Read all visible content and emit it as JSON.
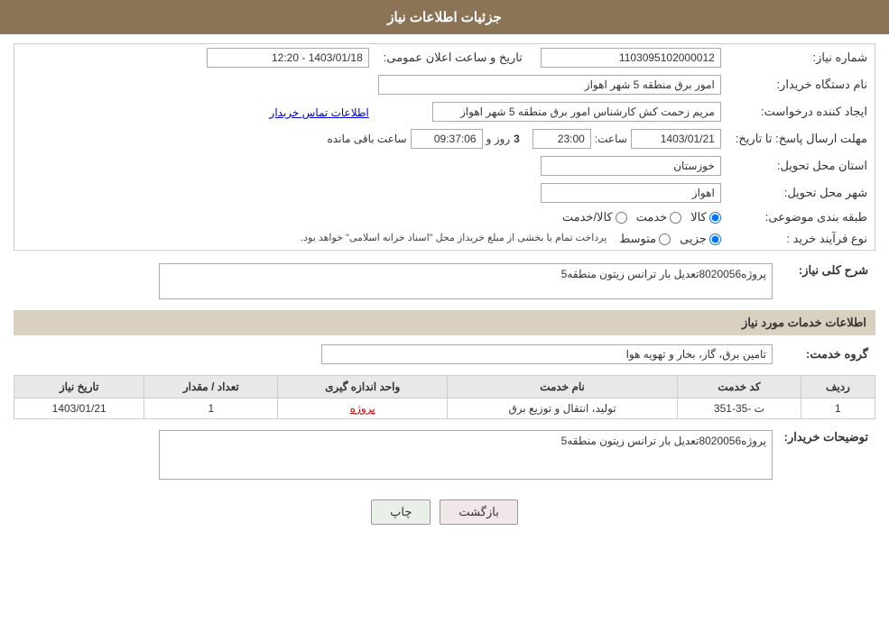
{
  "header": {
    "title": "جزئیات اطلاعات نیاز"
  },
  "form": {
    "shomara_niaz_label": "شماره نیاز:",
    "shomara_niaz_value": "1103095102000012",
    "name_dastgah_label": "نام دستگاه خریدار:",
    "name_dastgah_value": "امور برق منطقه 5 شهر اهواز",
    "tarikh_label": "تاریخ و ساعت اعلان عمومی:",
    "tarikh_value": "1403/01/18 - 12:20",
    "ijad_konande_label": "ایجاد کننده درخواست:",
    "ijad_konande_value": "مریم زحمت کش کارشناس امور برق منطقه 5 شهر اهواز",
    "contact_link": "اطلاعات تماس خریدار",
    "mohlat_label": "مهلت ارسال پاسخ: تا تاریخ:",
    "mohlat_date": "1403/01/21",
    "mohlat_saat_label": "ساعت:",
    "mohlat_saat_value": "23:00",
    "mohlat_roz_label": "روز و",
    "mohlat_roz_value": "3",
    "mohlat_mande_label": "ساعت باقی مانده",
    "mohlat_mande_value": "09:37:06",
    "ostan_label": "استان محل تحویل:",
    "ostan_value": "خوزستان",
    "shahr_label": "شهر محل تحویل:",
    "shahr_value": "اهواز",
    "tabaqe_label": "طبقه بندی موضوعی:",
    "tabaqe_options": [
      {
        "label": "کالا",
        "value": "kala"
      },
      {
        "label": "خدمت",
        "value": "khedmat"
      },
      {
        "label": "کالا/خدمت",
        "value": "kala_khedmat"
      }
    ],
    "tabaqe_selected": "kala",
    "noeFarayand_label": "نوع فرآیند خرید :",
    "noeFarayand_options": [
      {
        "label": "جزیی",
        "value": "jozii"
      },
      {
        "label": "متوسط",
        "value": "motavasset"
      }
    ],
    "noeFarayand_selected": "jozii",
    "noeFarayand_note": "پرداخت تمام یا بخشی از مبلغ خریداز محل \"اسناد خزانه اسلامی\" خواهد بود.",
    "sharh_label": "شرح کلی نیاز:",
    "sharh_value": "پروژه8020056تعدیل بار ترانس زیتون منطقه5",
    "khedmat_section_title": "اطلاعات خدمات مورد نیاز",
    "gorohe_khedmat_label": "گروه خدمت:",
    "gorohe_khedmat_value": "تامین برق، گاز، بخار و تهویه هوا",
    "table_headers": [
      "ردیف",
      "کد خدمت",
      "نام خدمت",
      "واحد اندازه گیری",
      "تعداد / مقدار",
      "تاریخ نیاز"
    ],
    "table_rows": [
      {
        "radif": "1",
        "kod": "ت -35-351",
        "name": "تولید، انتقال و توزیع برق",
        "vahed": "پروژه",
        "tedad": "1",
        "tarikh": "1403/01/21"
      }
    ],
    "tawsifat_label": "توضیحات خریدار:",
    "tawsifat_value": "پروژه8020056تعدیل بار ترانس زیتون منطقه5",
    "btn_print": "چاپ",
    "btn_back": "بازگشت"
  }
}
